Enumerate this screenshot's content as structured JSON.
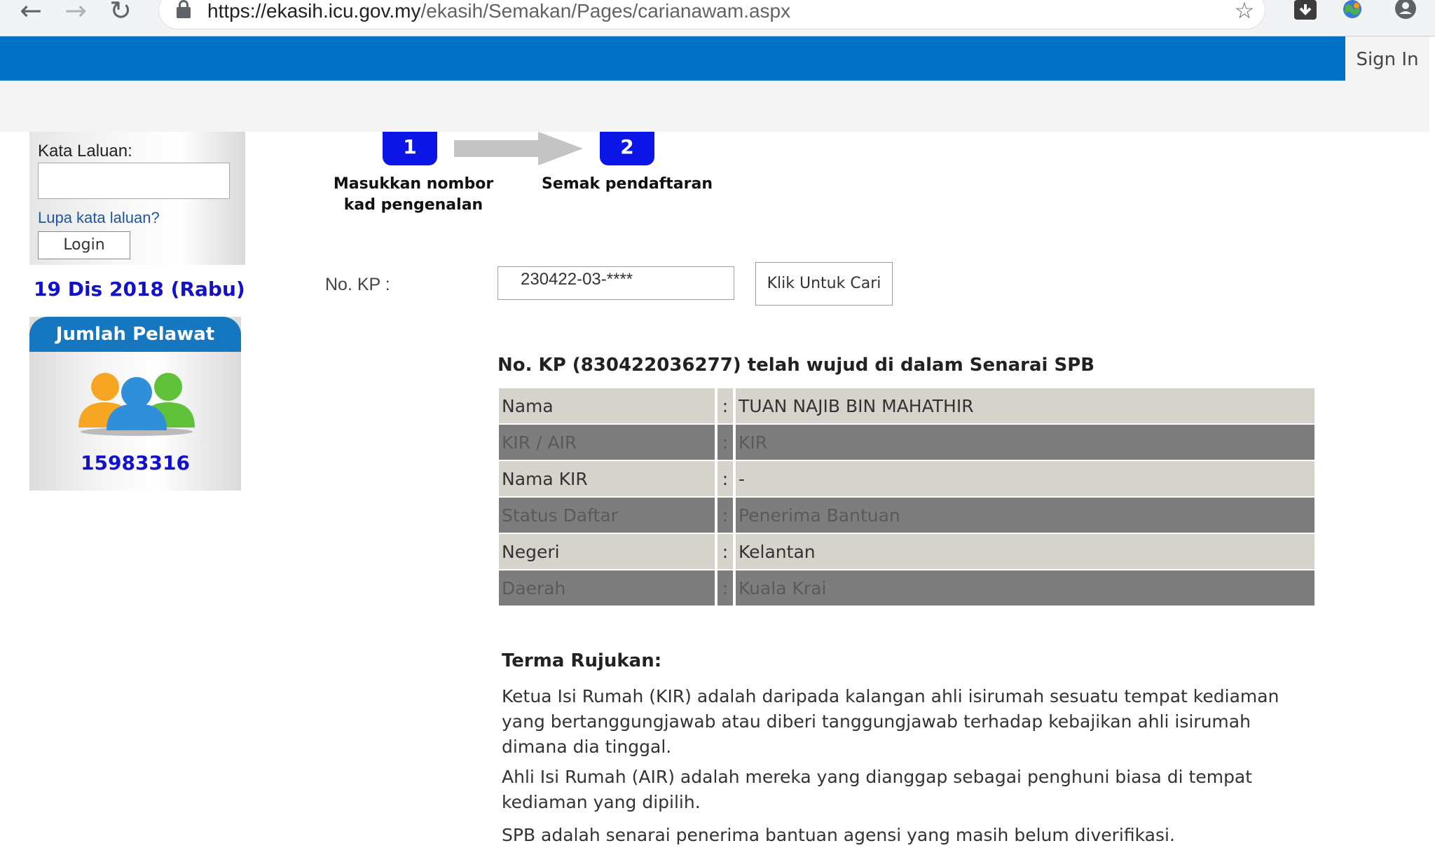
{
  "browser": {
    "url_host": "https://ekasih.icu.gov.my",
    "url_path": "/ekasih/Semakan/Pages/carianawam.aspx",
    "back_icon": "←",
    "forward_icon": "→",
    "reload_icon": "↻",
    "star_icon": "☆"
  },
  "header": {
    "sign_in": "Sign In",
    "bar_color": "#0072c6"
  },
  "sidebar": {
    "password_label": "Kata Laluan:",
    "password_value": "",
    "forgot_link": "Lupa kata laluan?",
    "login_button": "Login",
    "date": "19 Dis 2018 (Rabu)",
    "visitor_title": "Jumlah Pelawat",
    "visitor_count": "15983316"
  },
  "steps": [
    {
      "number": "1",
      "label_line1": "Masukkan nombor",
      "label_line2": "kad pengenalan"
    },
    {
      "number": "2",
      "label_line1": "Semak pendaftaran",
      "label_line2": ""
    }
  ],
  "search": {
    "label": "No. KP :",
    "value": "230422-03-****",
    "button": "Klik Untuk Cari"
  },
  "result": {
    "heading": "No. KP (830422036277) telah wujud di dalam Senarai SPB",
    "separator": ":",
    "rows": [
      {
        "label": "Nama",
        "value": "TUAN NAJIB BIN MAHATHIR"
      },
      {
        "label": "KIR / AIR",
        "value": "KIR"
      },
      {
        "label": "Nama KIR",
        "value": "-"
      },
      {
        "label": "Status Daftar",
        "value": "Penerima Bantuan"
      },
      {
        "label": "Negeri",
        "value": "Kelantan"
      },
      {
        "label": "Daerah",
        "value": "Kuala Krai"
      }
    ]
  },
  "terms": {
    "heading": "Terma Rujukan:",
    "paragraphs": [
      "Ketua Isi Rumah (KIR) adalah daripada kalangan ahli isirumah sesuatu tempat kediaman yang bertanggungjawab atau diberi tanggungjawab terhadap kebajikan ahli isirumah dimana dia tinggal.",
      "Ahli Isi Rumah (AIR) adalah mereka yang dianggap sebagai penghuni biasa di tempat kediaman yang dipilih.",
      "SPB adalah senarai penerima bantuan agensi yang masih belum diverifikasi."
    ]
  }
}
